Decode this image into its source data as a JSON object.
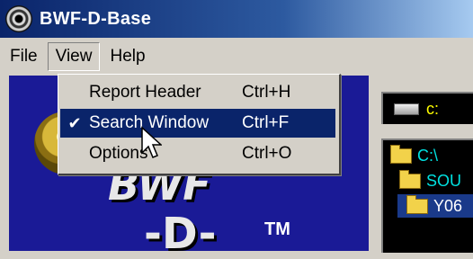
{
  "window": {
    "title": "BWF-D-Base"
  },
  "menubar": {
    "items": [
      "File",
      "View",
      "Help"
    ]
  },
  "view_menu": {
    "items": [
      {
        "label": "Report Header",
        "shortcut": "Ctrl+H",
        "checked": ""
      },
      {
        "label": "Search Window",
        "shortcut": "Ctrl+F",
        "checked": "✔"
      },
      {
        "label": "Options",
        "shortcut": "Ctrl+O",
        "checked": ""
      }
    ]
  },
  "logo": {
    "text_top": "BWF",
    "text_bottom": "-D-",
    "tm": "TM"
  },
  "drive": {
    "value": "c:"
  },
  "folders": [
    "C:\\",
    "SOU",
    "Y06"
  ],
  "colors": {
    "accent": "#0a246a",
    "logo_bg": "#1a1a96",
    "tree_text": "#00e0e0"
  }
}
